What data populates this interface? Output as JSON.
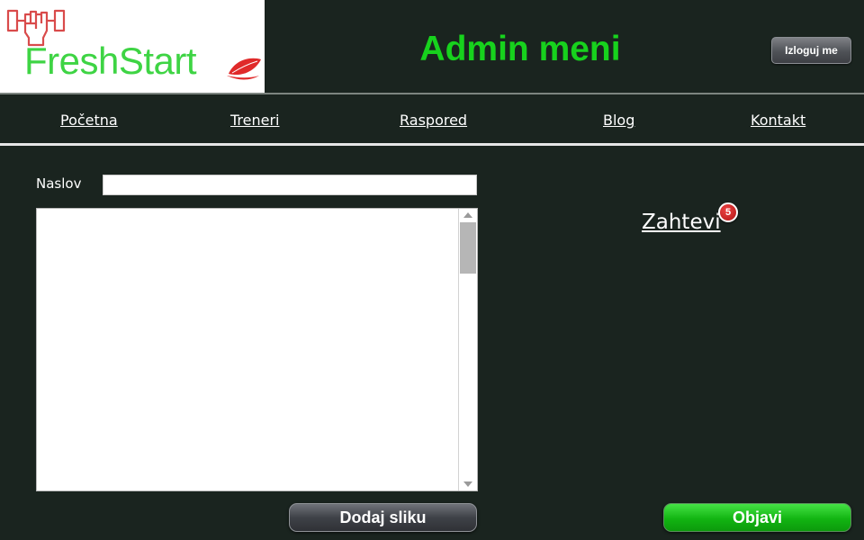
{
  "brand": {
    "name": "FreshStart",
    "accent": "#3ed444",
    "icon_color": "#d94b4b",
    "leaf_color": "#e02a2a"
  },
  "header": {
    "title": "Admin meni",
    "title_color": "#17d21d",
    "logout_label": "Izloguj me"
  },
  "nav": {
    "items": [
      {
        "label": "Početna"
      },
      {
        "label": "Treneri"
      },
      {
        "label": "Raspored"
      },
      {
        "label": "Blog"
      },
      {
        "label": "Kontakt"
      }
    ]
  },
  "form": {
    "title_label": "Naslov",
    "title_value": "",
    "body_value": ""
  },
  "requests": {
    "label": "Zahtevi",
    "count": "5"
  },
  "actions": {
    "add_image_label": "Dodaj sliku",
    "publish_label": "Objavi"
  },
  "colors": {
    "background": "#1a241f",
    "publish": "#12b512",
    "badge": "#c41c1c"
  }
}
